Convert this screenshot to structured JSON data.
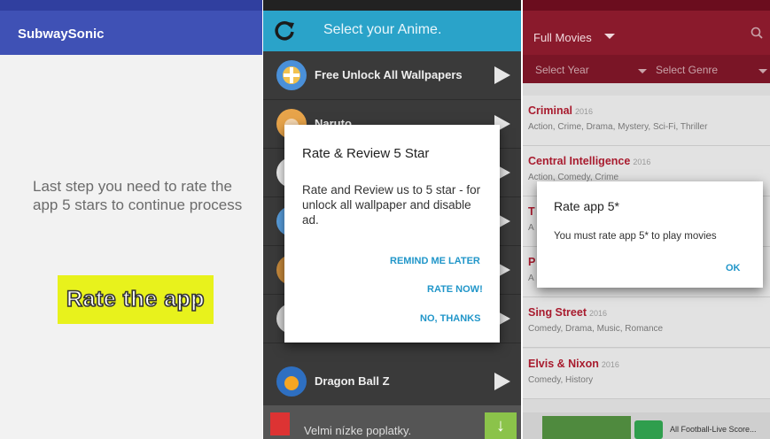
{
  "panel1": {
    "app_title": "SubwaySonic",
    "message": "Last step you need to rate the app 5 stars to continue process",
    "rate_button": "Rate the app"
  },
  "panel2": {
    "header_title": "Select your Anime.",
    "list": [
      {
        "label": "Free Unlock All Wallpapers",
        "icon": "wallpaper-icon"
      },
      {
        "label": "Naruto",
        "icon": "anime-avatar"
      },
      {
        "label": "",
        "icon": "anime-avatar"
      },
      {
        "label": "",
        "icon": "anime-avatar"
      },
      {
        "label": "",
        "icon": "anime-avatar"
      },
      {
        "label": "",
        "icon": "anime-avatar"
      },
      {
        "label": "Dragon Ball Z",
        "icon": "anime-avatar"
      }
    ],
    "ad_text": "Velmi nízke poplatky.",
    "dialog": {
      "title": "Rate & Review 5 Star",
      "body": "Rate and Review us to 5 star - for unlock all wallpaper and disable ad.",
      "buttons": [
        "REMIND ME LATER",
        "RATE NOW!",
        "NO, THANKS"
      ]
    }
  },
  "panel3": {
    "header_title": "Full Movies",
    "filter_year": "Select Year",
    "filter_genre": "Select Genre",
    "movies": [
      {
        "title": "Criminal",
        "year": "2016",
        "genres": "Action, Crime, Drama, Mystery, Sci-Fi, Thriller"
      },
      {
        "title": "Central Intelligence",
        "year": "2016",
        "genres": "Action, Comedy, Crime"
      },
      {
        "title": "T",
        "year": "",
        "genres": "A"
      },
      {
        "title": "P",
        "year": "",
        "genres": "A"
      },
      {
        "title": "Sing Street",
        "year": "2016",
        "genres": "Comedy, Drama, Music, Romance"
      },
      {
        "title": "Elvis & Nixon",
        "year": "2016",
        "genres": "Comedy, History"
      }
    ],
    "dialog": {
      "title": "Rate app 5*",
      "body": "You must rate app 5* to play movies",
      "ok": "OK"
    },
    "ad_text": "All Football-Live Score..."
  },
  "colors": {
    "panel1_appbar": "#3f51b5",
    "panel2_header": "#2aa3c9",
    "panel3_header": "#8a1a2c",
    "dialog_button": "#2196c9",
    "rate_button_bg": "#e8f21c"
  }
}
